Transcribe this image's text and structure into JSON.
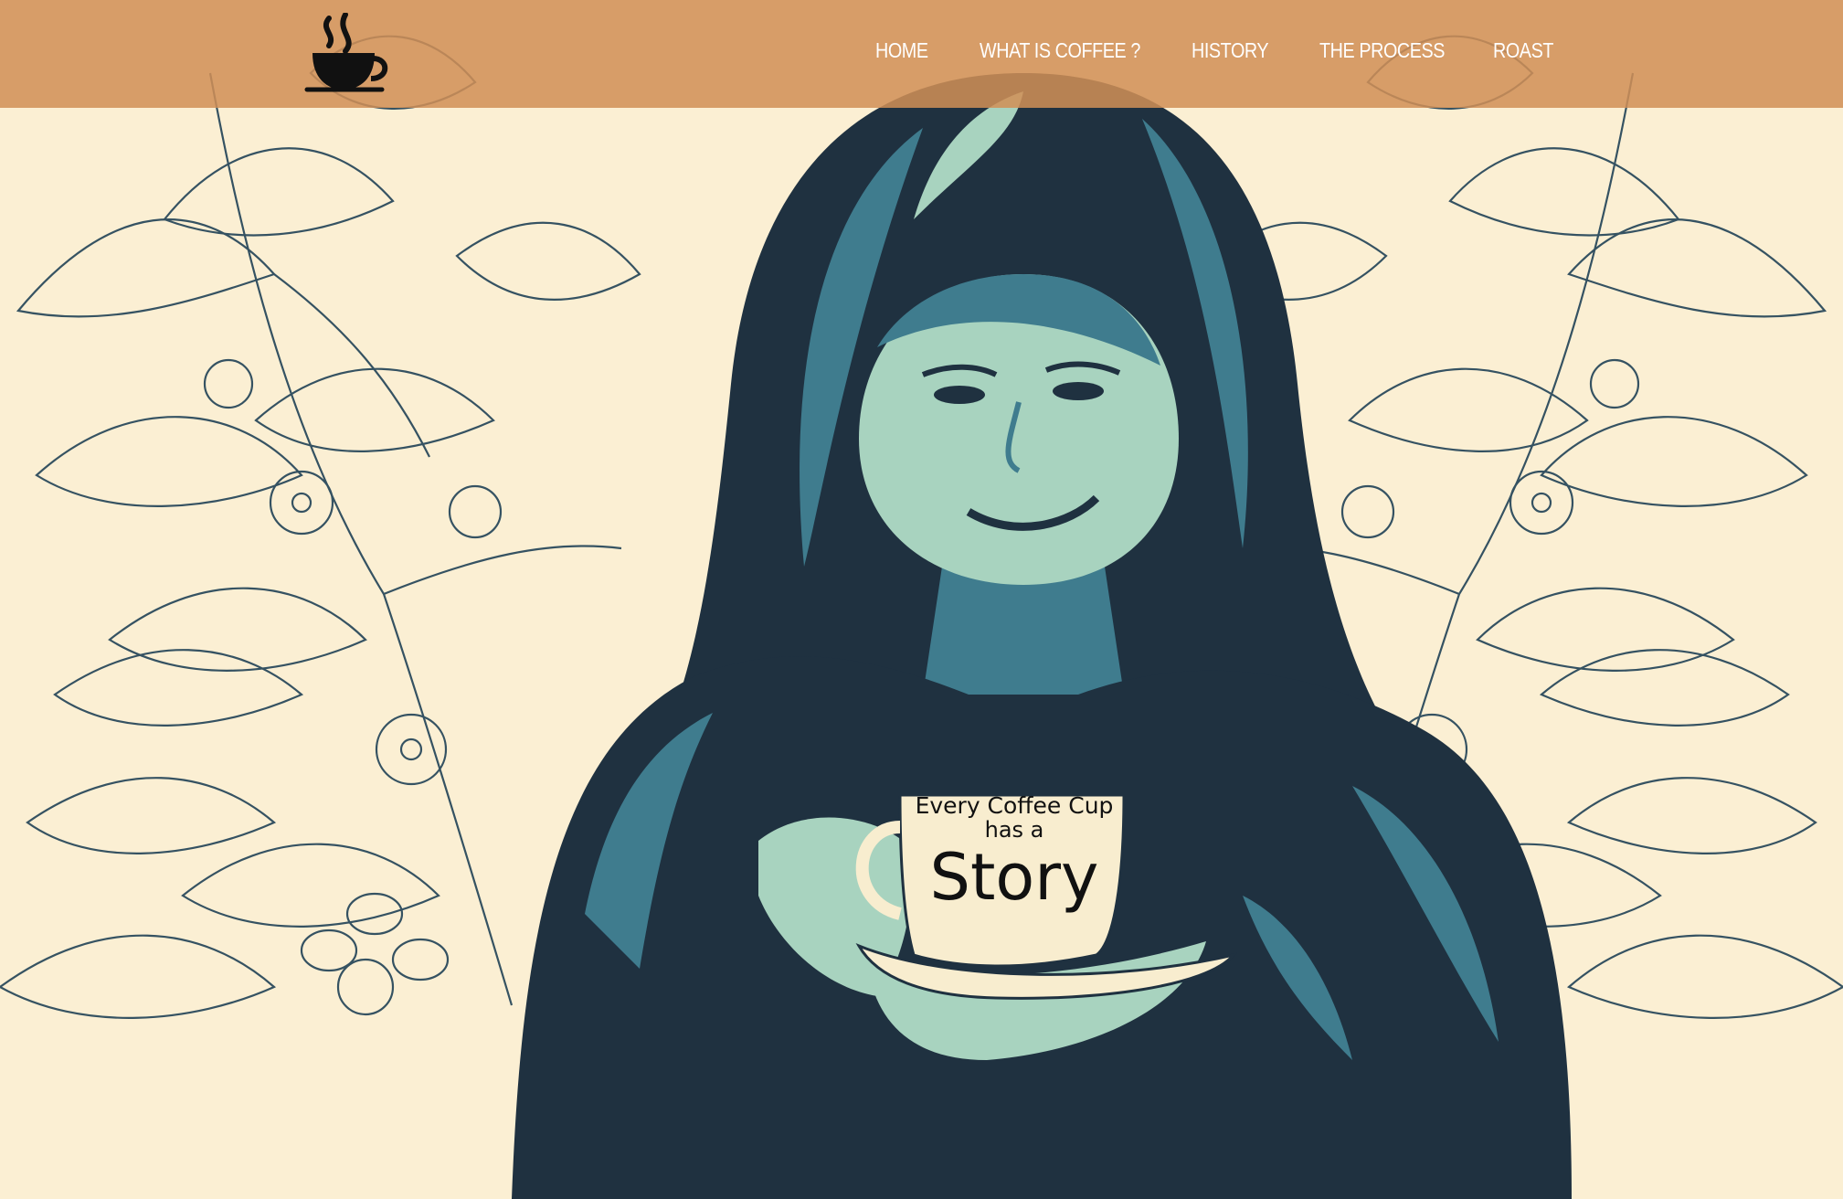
{
  "nav": {
    "logo_icon": "coffee-cup-logo-icon",
    "links": [
      {
        "label": "HOME"
      },
      {
        "label": "WHAT IS COFFEE ?"
      },
      {
        "label": "HISTORY"
      },
      {
        "label": "THE PROCESS"
      },
      {
        "label": "ROAST"
      }
    ]
  },
  "hero": {
    "cup_line1": "Every Coffee Cup",
    "cup_line2": "has a",
    "cup_story": "Story"
  },
  "colors": {
    "navbar": "#d18f56",
    "background": "#fbefd3",
    "line_art": "#2b4a5c",
    "portrait_dark": "#1f3140",
    "portrait_mid": "#3f7c8e",
    "portrait_light": "#a8d3bf",
    "cream": "#f8edcf"
  }
}
